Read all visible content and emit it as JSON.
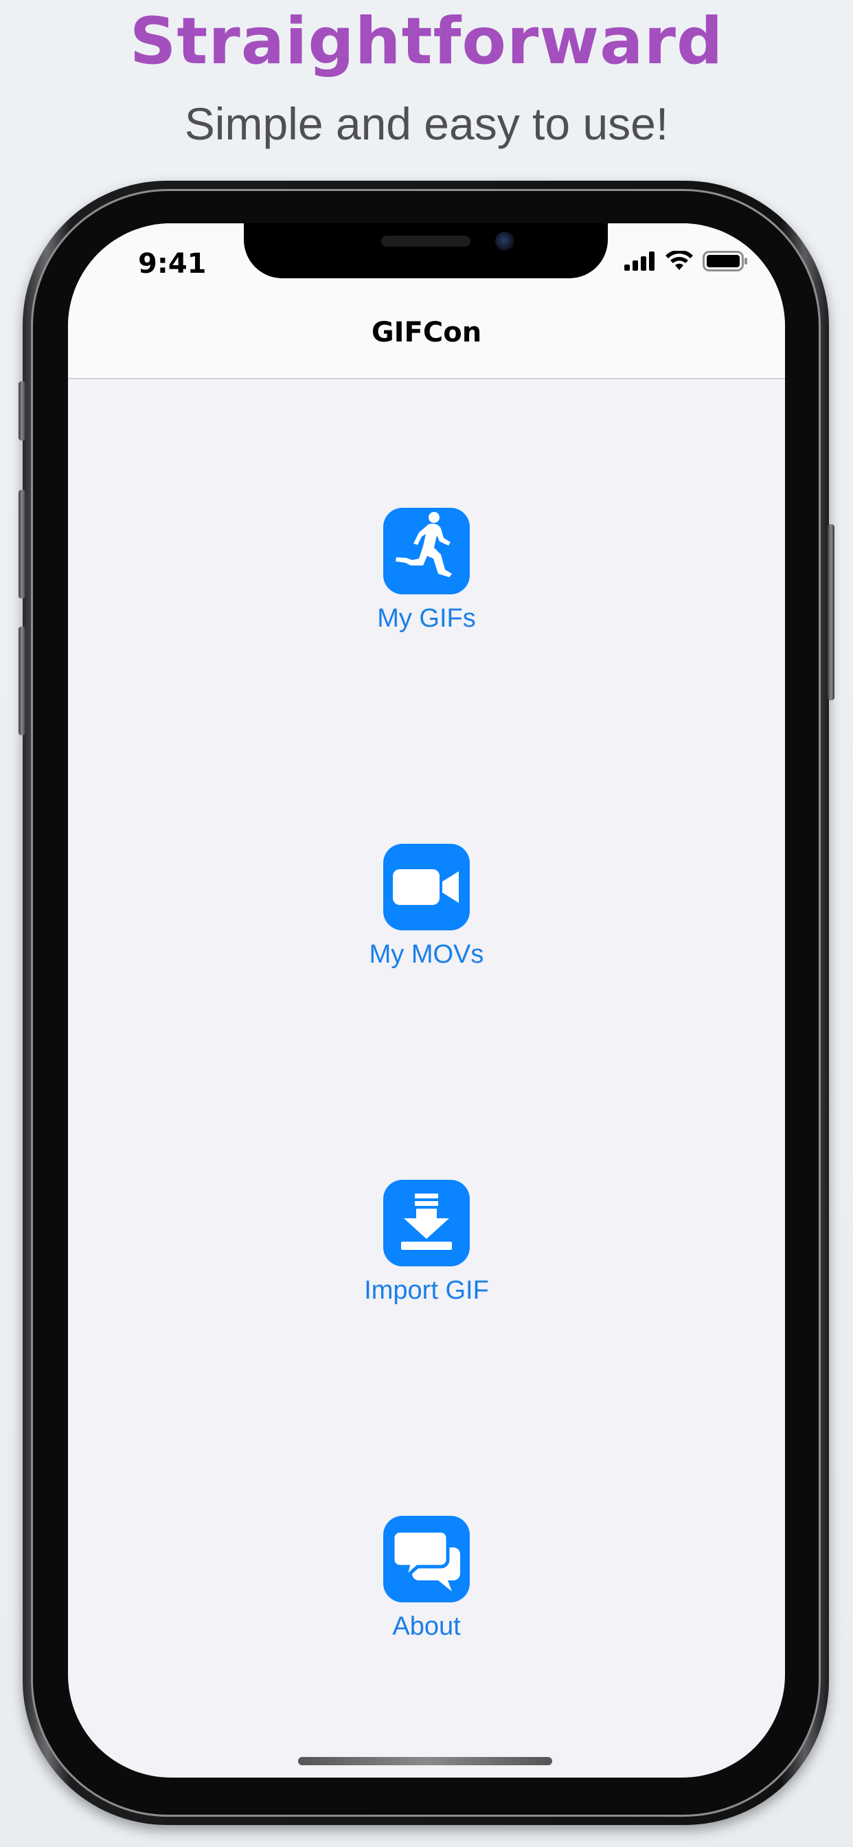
{
  "header": {
    "headline": "Straightforward",
    "subheadline": "Simple and easy to use!"
  },
  "status_bar": {
    "time": "9:41",
    "icons": [
      "signal-icon",
      "wifi-icon",
      "battery-icon"
    ]
  },
  "nav": {
    "title": "GIFCon"
  },
  "menu": [
    {
      "label": "My GIFs",
      "icon": "runner-icon"
    },
    {
      "label": "My MOVs",
      "icon": "video-camera-icon"
    },
    {
      "label": "Import GIF",
      "icon": "download-icon"
    },
    {
      "label": "About",
      "icon": "chat-bubbles-icon"
    }
  ],
  "colors": {
    "headline": "#a34fbe",
    "accent": "#0a84ff",
    "label": "#1a7fe8"
  }
}
